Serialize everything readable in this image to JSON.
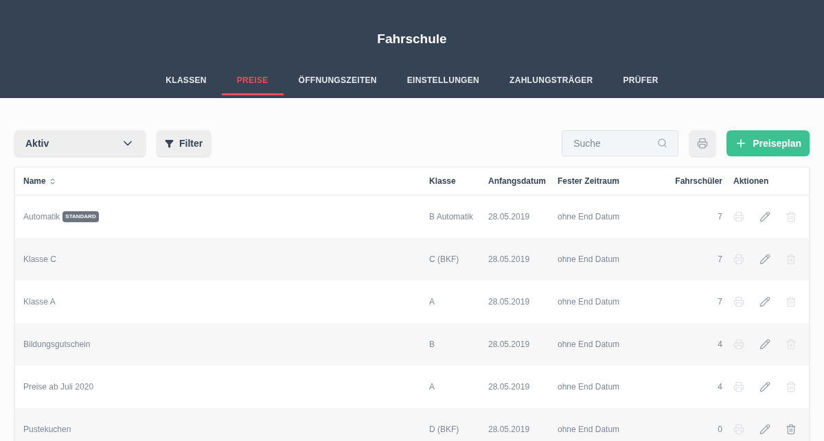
{
  "header": {
    "title": "Fahrschule"
  },
  "tabs": [
    {
      "label": "KLASSEN",
      "selected": false
    },
    {
      "label": "PREISE",
      "selected": true
    },
    {
      "label": "ÖFFNUNGSZEITEN",
      "selected": false
    },
    {
      "label": "EINSTELLUNGEN",
      "selected": false
    },
    {
      "label": "ZAHLUNGSTRÄGER",
      "selected": false
    },
    {
      "label": "PRÜFER",
      "selected": false
    }
  ],
  "toolbar": {
    "status_select": "Aktiv",
    "filter_button": "Filter",
    "search": {
      "placeholder": "Suche"
    },
    "add_button": "Preiseplan"
  },
  "table": {
    "columns": [
      "Name",
      "Klasse",
      "Anfangsdatum",
      "Fester Zeitraum",
      "Fahrschüler",
      "Aktionen"
    ],
    "rows": [
      {
        "name": "Automatik",
        "badge": "STANDARD",
        "klasse": "B Automatik",
        "start": "28.05.2019",
        "period": "ohne End Datum",
        "students": "7",
        "deletable": false
      },
      {
        "name": "Klasse C",
        "klasse": "C (BKF)",
        "start": "28.05.2019",
        "period": "ohne End Datum",
        "students": "7",
        "deletable": false
      },
      {
        "name": "Klasse A",
        "klasse": "A",
        "start": "28.05.2019",
        "period": "ohne End Datum",
        "students": "7",
        "deletable": false
      },
      {
        "name": "Bildungsgutschein",
        "klasse": "B",
        "start": "28.05.2019",
        "period": "ohne End Datum",
        "students": "4",
        "deletable": false
      },
      {
        "name": "Preise ab Juli 2020",
        "klasse": "A",
        "start": "28.05.2019",
        "period": "ohne End Datum",
        "students": "4",
        "deletable": false
      },
      {
        "name": "Pustekuchen",
        "klasse": "D (BKF)",
        "start": "28.05.2019",
        "period": "ohne End Datum",
        "students": "0",
        "deletable": true
      }
    ]
  }
}
